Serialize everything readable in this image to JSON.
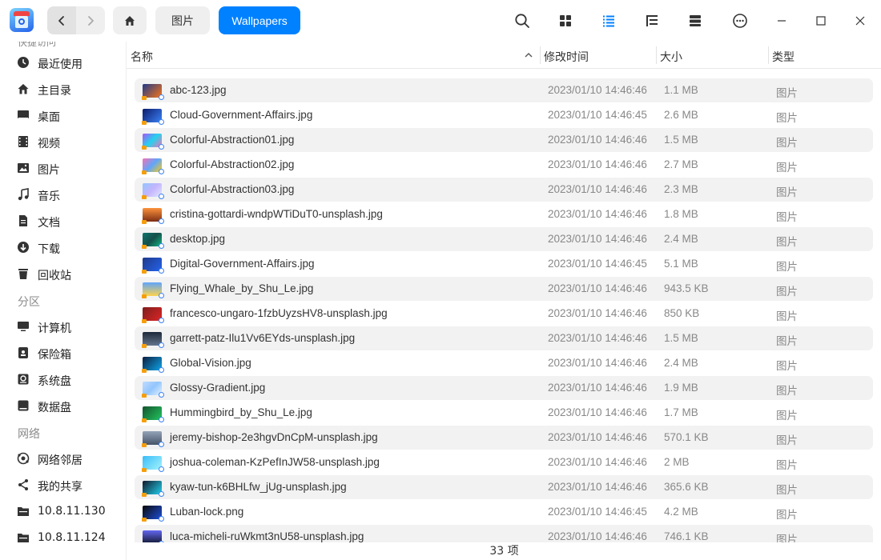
{
  "titlebar": {
    "breadcrumb": [
      "图片",
      "Wallpapers"
    ],
    "icons": [
      "search-icon",
      "grid-view-icon",
      "list-view-icon",
      "tree-view-icon",
      "details-pane-icon",
      "more-icon",
      "minimize-icon",
      "maximize-icon",
      "close-icon"
    ]
  },
  "sidebar": {
    "partial_top_label": "快捷访问",
    "items": [
      {
        "label": "最近使用",
        "icon": "clock-icon"
      },
      {
        "label": "主目录",
        "icon": "home-icon"
      },
      {
        "label": "桌面",
        "icon": "desktop-icon"
      },
      {
        "label": "视频",
        "icon": "video-icon"
      },
      {
        "label": "图片",
        "icon": "picture-icon"
      },
      {
        "label": "音乐",
        "icon": "music-icon"
      },
      {
        "label": "文档",
        "icon": "document-icon"
      },
      {
        "label": "下载",
        "icon": "download-icon"
      },
      {
        "label": "回收站",
        "icon": "trash-icon"
      }
    ],
    "partition_label": "分区",
    "partitions": [
      {
        "label": "计算机",
        "icon": "computer-icon"
      },
      {
        "label": "保险箱",
        "icon": "vault-icon"
      },
      {
        "label": "系统盘",
        "icon": "disk-icon"
      },
      {
        "label": "数据盘",
        "icon": "disk-icon"
      }
    ],
    "network_label": "网络",
    "network": [
      {
        "label": "网络邻居",
        "icon": "network-icon"
      },
      {
        "label": "我的共享",
        "icon": "share-icon"
      },
      {
        "label": "10.8.11.130",
        "icon": "server-icon"
      },
      {
        "label": "10.8.11.124",
        "icon": "server-icon"
      }
    ]
  },
  "columns": {
    "name": "名称",
    "modified": "修改时间",
    "size": "大小",
    "type": "类型"
  },
  "files": [
    {
      "name": "abc-123.jpg",
      "modified": "2023/01/10  14:46:46",
      "size": "1.1  MB",
      "type": "图片"
    },
    {
      "name": "Cloud-Government-Affairs.jpg",
      "modified": "2023/01/10  14:46:45",
      "size": "2.6  MB",
      "type": "图片"
    },
    {
      "name": "Colorful-Abstraction01.jpg",
      "modified": "2023/01/10  14:46:46",
      "size": "1.5  MB",
      "type": "图片"
    },
    {
      "name": "Colorful-Abstraction02.jpg",
      "modified": "2023/01/10  14:46:46",
      "size": "2.7  MB",
      "type": "图片"
    },
    {
      "name": "Colorful-Abstraction03.jpg",
      "modified": "2023/01/10  14:46:46",
      "size": "2.3  MB",
      "type": "图片"
    },
    {
      "name": "cristina-gottardi-wndpWTiDuT0-unsplash.jpg",
      "modified": "2023/01/10  14:46:46",
      "size": "1.8  MB",
      "type": "图片"
    },
    {
      "name": "desktop.jpg",
      "modified": "2023/01/10  14:46:46",
      "size": "2.4  MB",
      "type": "图片"
    },
    {
      "name": "Digital-Government-Affairs.jpg",
      "modified": "2023/01/10  14:46:45",
      "size": "5.1  MB",
      "type": "图片"
    },
    {
      "name": "Flying_Whale_by_Shu_Le.jpg",
      "modified": "2023/01/10  14:46:46",
      "size": "943.5  KB",
      "type": "图片"
    },
    {
      "name": "francesco-ungaro-1fzbUyzsHV8-unsplash.jpg",
      "modified": "2023/01/10  14:46:46",
      "size": "850  KB",
      "type": "图片"
    },
    {
      "name": "garrett-patz-Ilu1Vv6EYds-unsplash.jpg",
      "modified": "2023/01/10  14:46:46",
      "size": "1.5  MB",
      "type": "图片"
    },
    {
      "name": "Global-Vision.jpg",
      "modified": "2023/01/10  14:46:46",
      "size": "2.4  MB",
      "type": "图片"
    },
    {
      "name": "Glossy-Gradient.jpg",
      "modified": "2023/01/10  14:46:46",
      "size": "1.9  MB",
      "type": "图片"
    },
    {
      "name": "Hummingbird_by_Shu_Le.jpg",
      "modified": "2023/01/10  14:46:46",
      "size": "1.7  MB",
      "type": "图片"
    },
    {
      "name": "jeremy-bishop-2e3hgvDnCpM-unsplash.jpg",
      "modified": "2023/01/10  14:46:46",
      "size": "570.1  KB",
      "type": "图片"
    },
    {
      "name": "joshua-coleman-KzPefInJW58-unsplash.jpg",
      "modified": "2023/01/10  14:46:46",
      "size": "2  MB",
      "type": "图片"
    },
    {
      "name": "kyaw-tun-k6BHLfw_jUg-unsplash.jpg",
      "modified": "2023/01/10  14:46:46",
      "size": "365.6  KB",
      "type": "图片"
    },
    {
      "name": "Luban-lock.png",
      "modified": "2023/01/10  14:46:45",
      "size": "4.2  MB",
      "type": "图片"
    },
    {
      "name": "luca-micheli-ruWkmt3nU58-unsplash.jpg",
      "modified": "2023/01/10  14:46:46",
      "size": "746.1  KB",
      "type": "图片"
    }
  ],
  "status": {
    "count": "33  项"
  },
  "colors": {
    "accent": "#0081ff",
    "row_alt": "#f2f2f2"
  }
}
